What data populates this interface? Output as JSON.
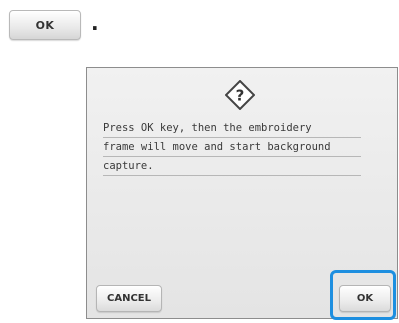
{
  "instruction": {
    "key_label": "OK",
    "trailing_punctuation": "."
  },
  "dialog": {
    "icon": "question-mark-diamond-icon",
    "message_lines": [
      "Press OK key, then the embroidery",
      "frame will move and start background",
      "capture."
    ],
    "cancel_label": "CANCEL",
    "ok_label": "OK",
    "highlight_color": "#1e8fe0"
  }
}
